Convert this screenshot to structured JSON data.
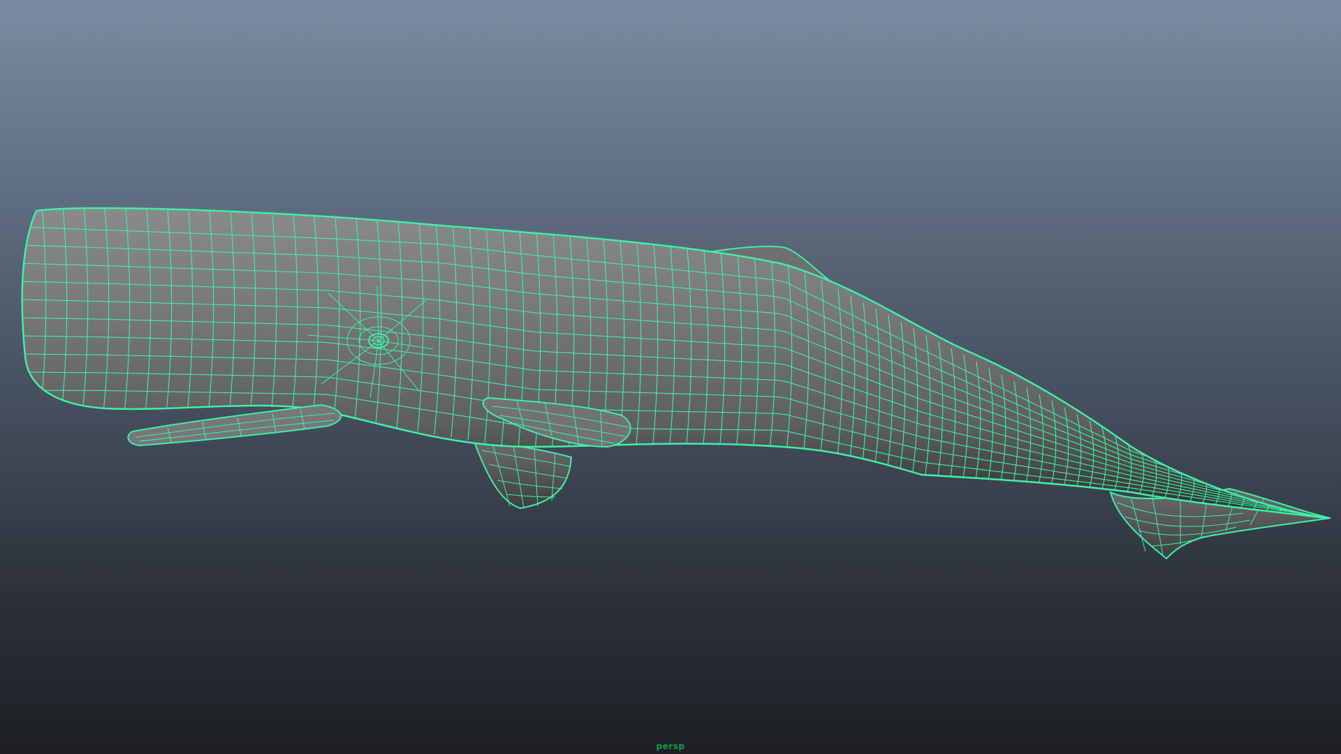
{
  "viewport": {
    "camera_name": "persp",
    "label_color": "#0fa24a",
    "wire_color": "#3cf2a7",
    "model": "sperm-whale-mesh"
  }
}
